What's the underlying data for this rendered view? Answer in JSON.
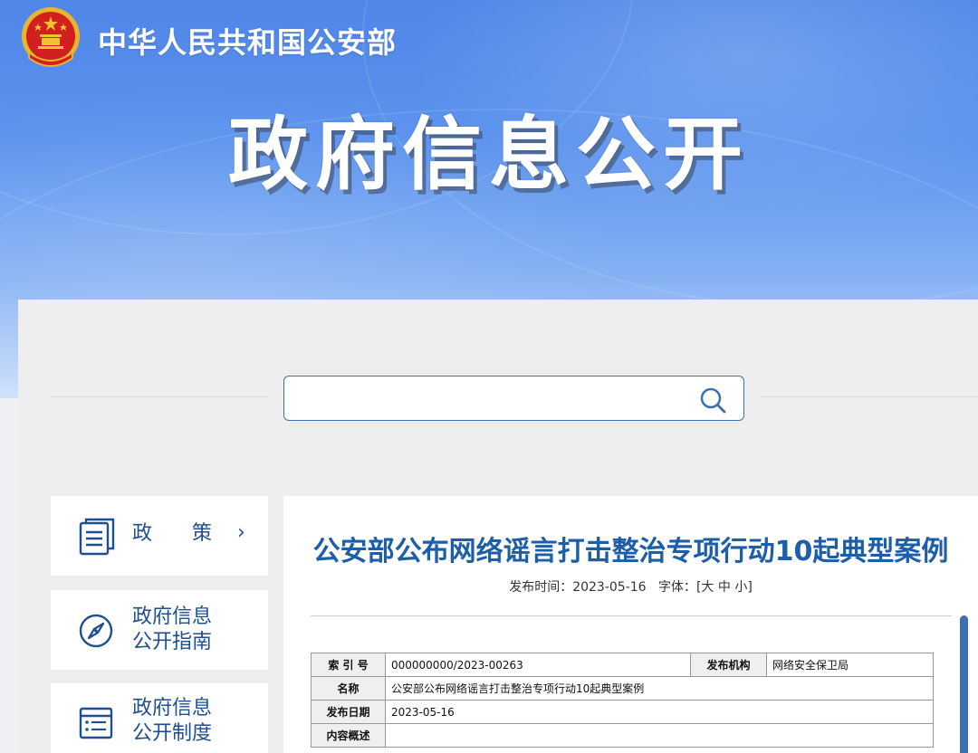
{
  "header": {
    "ministry_name": "中华人民共和国公安部",
    "page_title": "政府信息公开"
  },
  "search": {
    "value": "",
    "placeholder": ""
  },
  "sidebar": {
    "items": [
      {
        "label": "政策",
        "icon": "document-list-icon",
        "chevron": "›"
      },
      {
        "label_line1": "政府信息",
        "label_line2": "公开指南",
        "icon": "compass-icon"
      },
      {
        "label_line1": "政府信息",
        "label_line2": "公开制度",
        "icon": "list-icon"
      }
    ]
  },
  "article": {
    "title": "公安部公布网络谣言打击整治专项行动10起典型案例",
    "publish_label": "发布时间：",
    "publish_time": "2023-05-16",
    "font_label": "字体：",
    "font_open": "[",
    "font_large": "大",
    "font_medium": "中",
    "font_small": "小",
    "font_close": "]",
    "info_table": {
      "index_label": "索 引 号",
      "index_value": "000000000/2023-00263",
      "org_label": "发布机构",
      "org_value": "网络安全保卫局",
      "name_label": "名称",
      "name_value": "公安部公布网络谣言打击整治专项行动10起典型案例",
      "date_label": "发布日期",
      "date_value": "2023-05-16",
      "summary_label": "内容概述",
      "summary_value": ""
    }
  },
  "colors": {
    "banner_blue": "#5c93ee",
    "title_blue": "#1d5ea8",
    "nav_blue": "#1f4f8f",
    "emblem_red": "#d21f1f",
    "emblem_gold": "#f2c230"
  }
}
